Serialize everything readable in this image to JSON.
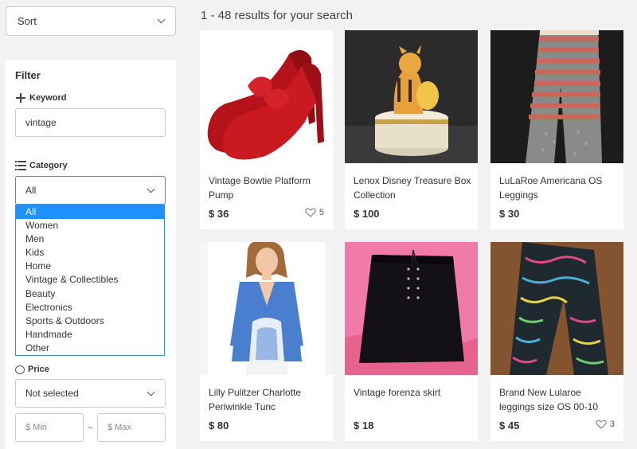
{
  "sort": {
    "label": "Sort"
  },
  "filter": {
    "title": "Filter",
    "keyword_label": "Keyword",
    "keyword_value": "vintage",
    "category_label": "Category",
    "category_selected": "All",
    "category_options": [
      "All",
      "Women",
      "Men",
      "Kids",
      "Home",
      "Vintage & Collectibles",
      "Beauty",
      "Electronics",
      "Sports & Outdoors",
      "Handmade",
      "Other"
    ],
    "price_label": "Price",
    "price_selected": "Not selected",
    "min_placeholder": "$ Min",
    "max_placeholder": "$ Max",
    "range_sep": "~"
  },
  "results_text": "1 - 48 results for your search",
  "items": [
    {
      "title": "Vintage Bowtie Platform Pump",
      "price": "$ 36",
      "likes": "5"
    },
    {
      "title": "Lenox Disney Treasure Box Collection",
      "price": "$ 100",
      "likes": ""
    },
    {
      "title": "LuLaRoe Americana OS Leggings",
      "price": "$ 30",
      "likes": ""
    },
    {
      "title": "Lilly Pulitzer Charlotte Periwinkle Tunc",
      "price": "$ 80",
      "likes": ""
    },
    {
      "title": "Vintage forenza skirt",
      "price": "$ 18",
      "likes": ""
    },
    {
      "title": "Brand New Lularoe leggings size OS 00-10",
      "price": "$ 45",
      "likes": "3"
    }
  ],
  "colors": {
    "accent": "#3c8fd5",
    "selected": "#1e90ff"
  }
}
